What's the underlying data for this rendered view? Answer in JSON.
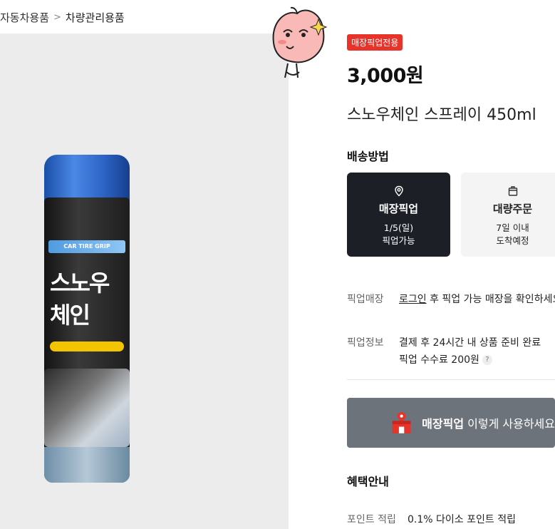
{
  "breadcrumb": {
    "parent": "자동차용품",
    "separator": ">",
    "current": "차량관리용품"
  },
  "product": {
    "badge": "매장픽업전용",
    "price": "3,000원",
    "name": "스노우체인 스프레이 450ml",
    "can_text": {
      "brand": "CAR TIRE GRIP",
      "line1": "스노우",
      "line2": "체인"
    }
  },
  "shipping": {
    "title": "배송방법",
    "options": [
      {
        "label": "매장픽업",
        "line1": "1/5(일)",
        "line2": "픽업가능",
        "icon": "location-pin-icon",
        "selected": true
      },
      {
        "label": "대량주문",
        "line1": "7일 이내",
        "line2": "도착예정",
        "icon": "box-icon",
        "selected": false
      }
    ]
  },
  "pickup_store": {
    "label": "픽업매장",
    "link": "로그인",
    "text": " 후 픽업 가능 매장을 확인하세요"
  },
  "pickup_info": {
    "label": "픽업정보",
    "line1": "결제 후 24시간 내 상품 준비 완료",
    "line2": "픽업 수수료 200원",
    "help": "?"
  },
  "banner": {
    "bold": "매장픽업",
    "text": " 이렇게 사용하세요",
    "icon": "store-icon"
  },
  "benefits": {
    "title": "혜택안내",
    "point_label": "포인트 적립",
    "point_value": "0.1% 다이소 포인트 적립"
  },
  "colors": {
    "badge": "#e8332a",
    "selected_card": "#1c1f26",
    "banner": "#6c737b"
  }
}
